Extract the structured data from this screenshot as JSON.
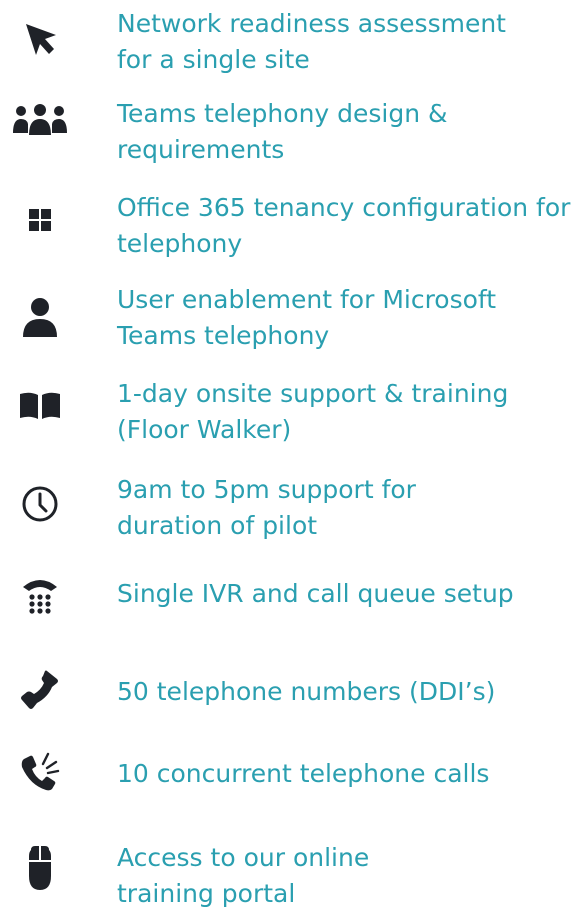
{
  "colors": {
    "icon": "#1f2228",
    "text": "#2a9fb0"
  },
  "features": [
    {
      "icon": "arrow-cursor-icon",
      "lines": [
        "Network readiness assessment",
        "for a single site"
      ]
    },
    {
      "icon": "people-group-icon",
      "lines": [
        "Teams telephony design &",
        "requirements"
      ]
    },
    {
      "icon": "grid-squares-icon",
      "lines": [
        "Office 365 tenancy configuration for",
        "telephony"
      ]
    },
    {
      "icon": "user-icon",
      "lines": [
        "User enablement for Microsoft",
        "Teams telephony"
      ]
    },
    {
      "icon": "open-book-icon",
      "lines": [
        "1-day onsite support & training",
        "(Floor Walker)"
      ]
    },
    {
      "icon": "clock-icon",
      "lines": [
        "9am to 5pm support for",
        "duration of pilot"
      ]
    },
    {
      "icon": "desk-phone-keypad-icon",
      "lines": [
        "Single IVR and call queue setup"
      ]
    },
    {
      "icon": "phone-handset-icon",
      "lines": [
        "50 telephone numbers (DDI’s)"
      ]
    },
    {
      "icon": "ringing-phone-icon",
      "lines": [
        "10 concurrent telephone calls"
      ]
    },
    {
      "icon": "computer-mouse-icon",
      "lines": [
        "Access to our online",
        "training portal"
      ]
    }
  ]
}
